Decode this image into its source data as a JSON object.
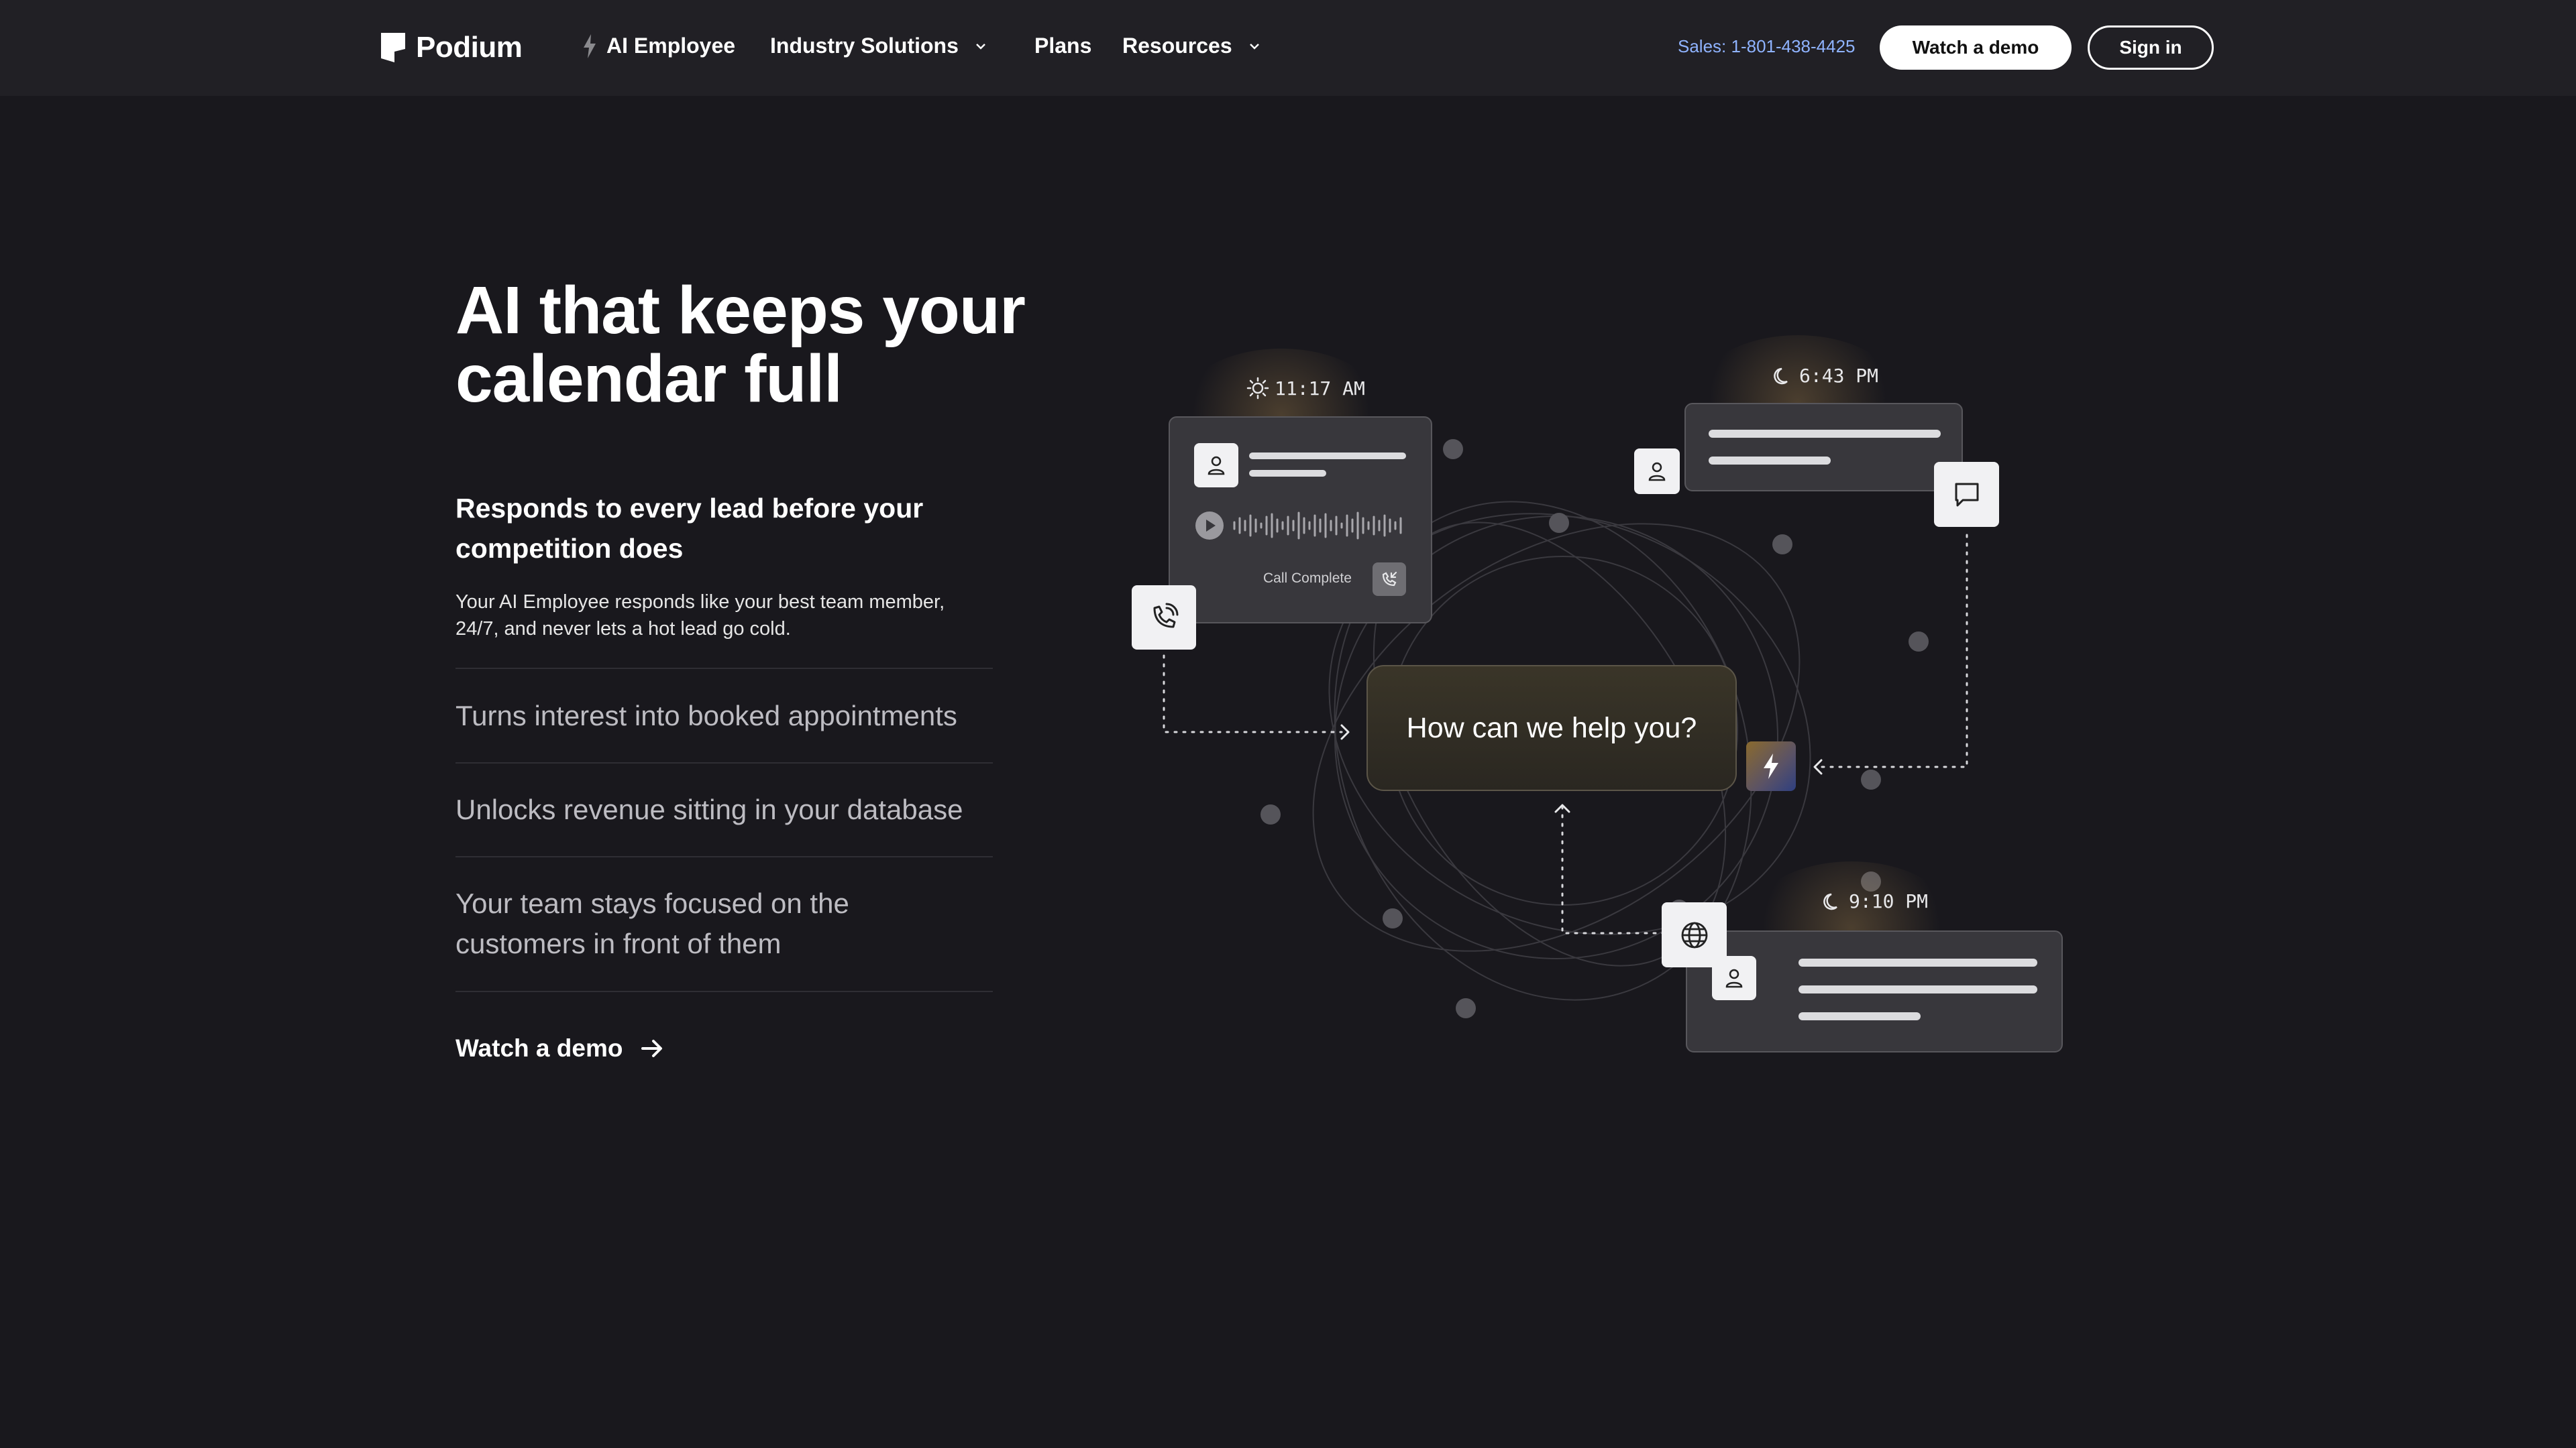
{
  "brand": {
    "name": "Podium"
  },
  "nav": {
    "ai_employee": "AI Employee",
    "industry": "Industry Solutions",
    "plans": "Plans",
    "resources": "Resources",
    "sales": "Sales: 1-801-438-4425",
    "watch_demo": "Watch a demo",
    "sign_in": "Sign in"
  },
  "hero": {
    "title_line1": "AI that keeps your",
    "title_line2": "calendar full",
    "subhead": "Responds to every lead before your competition does",
    "description": "Your AI Employee responds like your best team member, 24/7, and never lets a hot lead go cold.",
    "features": [
      "Turns interest into booked appointments",
      "Unlocks revenue sitting in your database",
      "Your team stays focused on the customers in front of them"
    ],
    "cta": "Watch a demo"
  },
  "illustration": {
    "time_1": "11:17 AM",
    "time_2": "6:43 PM",
    "time_3": "9:10 PM",
    "call_status": "Call Complete",
    "chat_prompt": "How can we help you?"
  },
  "colors": {
    "background": "#19181d",
    "nav": "#212025",
    "link": "#8fb3ff"
  }
}
